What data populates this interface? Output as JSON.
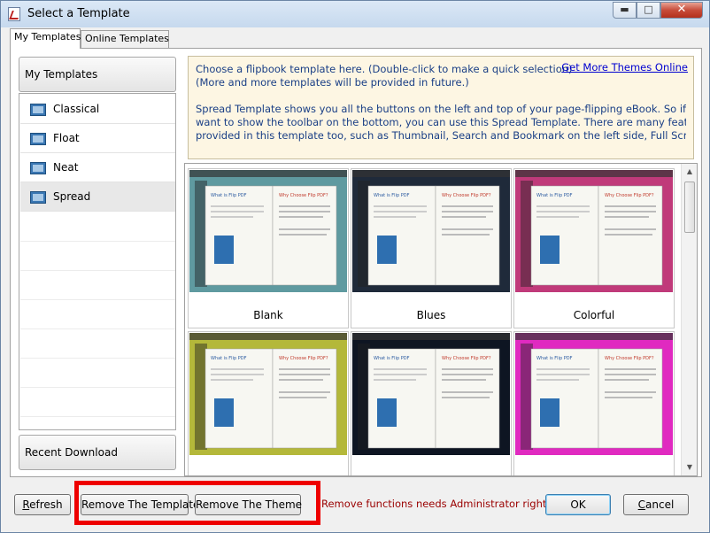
{
  "window": {
    "title": "Select a Template",
    "controls": {
      "minimize": "▬",
      "maximize": "□",
      "close": "✕"
    }
  },
  "tabs": [
    {
      "label": "My Templates",
      "active": true
    },
    {
      "label": "Online Templates",
      "active": false
    }
  ],
  "sidebar": {
    "header": "My Templates",
    "items": [
      {
        "label": "Classical",
        "selected": false
      },
      {
        "label": "Float",
        "selected": false
      },
      {
        "label": "Neat",
        "selected": false
      },
      {
        "label": "Spread",
        "selected": true
      }
    ],
    "footer": "Recent Download"
  },
  "info": {
    "line1": "Choose a flipbook template here. (Double-click to make a quick selection)",
    "line2": "(More and more templates will be provided in future.)",
    "link": "Get More Themes Online",
    "desc1": "Spread Template shows you all the buttons on the left and top of your page-flipping eBook. So if you don't",
    "desc2": "want to show the toolbar on the bottom, you can use this Spread Template. There are many features",
    "desc3": "provided in this template too, such as Thumbnail, Search and Bookmark on the left side, Full Screen, Social"
  },
  "gallery": {
    "cards": [
      {
        "name": "Blank",
        "bg": "#5f9aa0"
      },
      {
        "name": "Blues",
        "bg": "#1f2a3a"
      },
      {
        "name": "Colorful",
        "bg": "#c03a7a"
      },
      {
        "name": "",
        "bg": "#b4b83a"
      },
      {
        "name": "",
        "bg": "#0e1522"
      },
      {
        "name": "",
        "bg": "#e02ac0"
      }
    ],
    "book_texts": {
      "what": "What is Flip PDF",
      "why": "Why Choose Flip PDF?",
      "brand": "Flip PDF"
    }
  },
  "footer": {
    "refresh_prefix": "",
    "refresh_u": "R",
    "refresh_rest": "efresh",
    "remove_template": "Remove The Template",
    "remove_theme": "Remove The Theme",
    "admin_note": "Remove functions needs Administrator rights!",
    "ok": "OK",
    "cancel_u": "C",
    "cancel_rest": "ancel"
  },
  "colors": {
    "highlight": "#ee0000",
    "info_text": "#1a3f86",
    "link": "#0000d0",
    "note": "#9a0000"
  }
}
